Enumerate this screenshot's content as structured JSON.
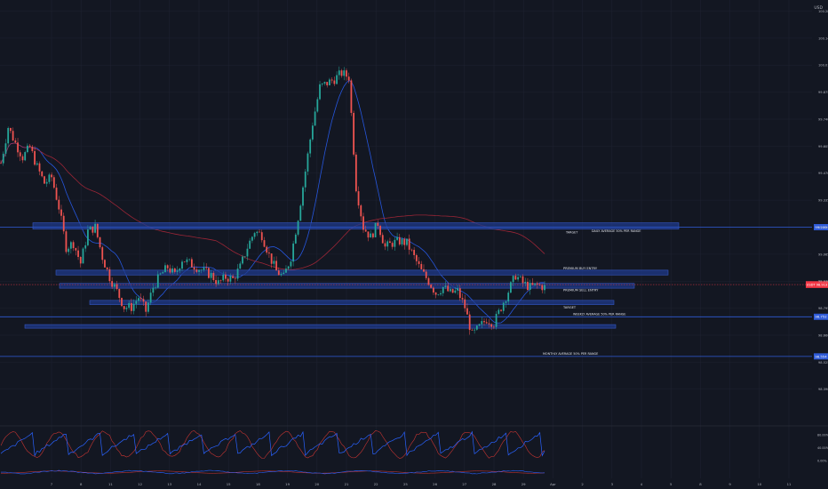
{
  "header": {
    "currency": "USD"
  },
  "colors": {
    "background": "#131722",
    "grid": "#1e2230",
    "candle_up": "#26a69a",
    "candle_down": "#ef5350",
    "zone_fill": "#1f3a8a",
    "zone_stroke": "#3557c4",
    "level_line": "#2f5bd8",
    "ma_blue": "#2962ff",
    "ma_red": "#b2283a",
    "price_tag": "#f23645",
    "osc_blue": "#2962ff",
    "osc_red": "#e53935"
  },
  "chart_data": {
    "type": "candlestick",
    "y_axis": {
      "min": 98.3,
      "max": 100.3,
      "ticks": [
        "100.280",
        "100.145",
        "100.010",
        "99.875",
        "99.740",
        "99.605",
        "99.470",
        "99.335",
        "99.200",
        "99.065",
        "98.930",
        "98.795",
        "98.660",
        "98.525",
        "98.390"
      ]
    },
    "x_axis": {
      "ticks": [
        "7",
        "8",
        "11",
        "12",
        "13",
        "14",
        "15",
        "18",
        "19",
        "20",
        "21",
        "22",
        "25",
        "26",
        "27",
        "28",
        "29",
        "Apr",
        "2",
        "3",
        "4",
        "5",
        "8",
        "9",
        "10",
        "11"
      ]
    },
    "price_path": [
      [
        0,
        99.52
      ],
      [
        2,
        99.7
      ],
      [
        4,
        99.62
      ],
      [
        6,
        99.55
      ],
      [
        8,
        99.6
      ],
      [
        10,
        99.5
      ],
      [
        12,
        99.42
      ],
      [
        14,
        99.45
      ],
      [
        16,
        99.3
      ],
      [
        18,
        99.1
      ],
      [
        20,
        99.12
      ],
      [
        22,
        99.02
      ],
      [
        24,
        99.18
      ],
      [
        26,
        99.2
      ],
      [
        28,
        99.05
      ],
      [
        30,
        98.95
      ],
      [
        32,
        98.88
      ],
      [
        34,
        98.8
      ],
      [
        36,
        98.8
      ],
      [
        38,
        98.85
      ],
      [
        40,
        98.78
      ],
      [
        42,
        98.9
      ],
      [
        44,
        98.96
      ],
      [
        46,
        99.0
      ],
      [
        48,
        98.96
      ],
      [
        50,
        99.04
      ],
      [
        52,
        99.02
      ],
      [
        54,
        99.0
      ],
      [
        56,
        98.98
      ],
      [
        58,
        98.96
      ],
      [
        60,
        98.92
      ],
      [
        62,
        98.95
      ],
      [
        64,
        98.94
      ],
      [
        66,
        99.0
      ],
      [
        68,
        99.1
      ],
      [
        70,
        99.18
      ],
      [
        72,
        99.16
      ],
      [
        74,
        99.06
      ],
      [
        76,
        98.98
      ],
      [
        78,
        98.95
      ],
      [
        80,
        99.05
      ],
      [
        82,
        99.25
      ],
      [
        84,
        99.48
      ],
      [
        86,
        99.72
      ],
      [
        88,
        99.9
      ],
      [
        90,
        99.92
      ],
      [
        92,
        99.94
      ],
      [
        94,
        99.97
      ],
      [
        96,
        99.95
      ],
      [
        98,
        99.4
      ],
      [
        100,
        99.2
      ],
      [
        102,
        99.15
      ],
      [
        104,
        99.22
      ],
      [
        106,
        99.1
      ],
      [
        108,
        99.12
      ],
      [
        110,
        99.13
      ],
      [
        112,
        99.12
      ],
      [
        114,
        99.05
      ],
      [
        116,
        98.98
      ],
      [
        118,
        98.93
      ],
      [
        120,
        98.87
      ],
      [
        122,
        98.9
      ],
      [
        124,
        98.87
      ],
      [
        126,
        98.88
      ],
      [
        128,
        98.8
      ],
      [
        130,
        98.66
      ],
      [
        132,
        98.7
      ],
      [
        134,
        98.74
      ],
      [
        136,
        98.72
      ],
      [
        138,
        98.8
      ],
      [
        140,
        98.88
      ],
      [
        142,
        98.96
      ],
      [
        144,
        98.92
      ],
      [
        146,
        98.9
      ],
      [
        148,
        98.91
      ],
      [
        150,
        98.9
      ]
    ],
    "current_price": {
      "value": 98.913,
      "label": "USDT 98.913"
    },
    "zones": [
      {
        "low": 99.19,
        "high": 99.222,
        "label": ""
      },
      {
        "low": 98.961,
        "high": 98.985,
        "label": "PREMIUM BUY ENTRY"
      },
      {
        "low": 98.895,
        "high": 98.919,
        "label": "PREMIUM SELL ENTRY"
      },
      {
        "low": 98.813,
        "high": 98.834,
        "label": "TARGET"
      },
      {
        "low": 98.695,
        "high": 98.713,
        "label": ""
      }
    ],
    "levels": [
      {
        "value": 99.2,
        "tag": "99.200",
        "label": "DAILY AVERAGE 50% PER RANGE"
      },
      {
        "value": 98.752,
        "tag": "98.752",
        "label": "WEEKLY AVERAGE 50% PER RANGE"
      },
      {
        "value": 98.554,
        "tag": "98.554",
        "label": "MONTHLY AVERAGE 50% PER RANGE"
      }
    ],
    "extra_labels": [
      {
        "text": "TARGET",
        "value": 99.168
      }
    ],
    "oscillator": {
      "ticks": [
        "80.00%",
        "40.00%",
        "0.00%"
      ],
      "min": 0,
      "max": 100
    }
  }
}
